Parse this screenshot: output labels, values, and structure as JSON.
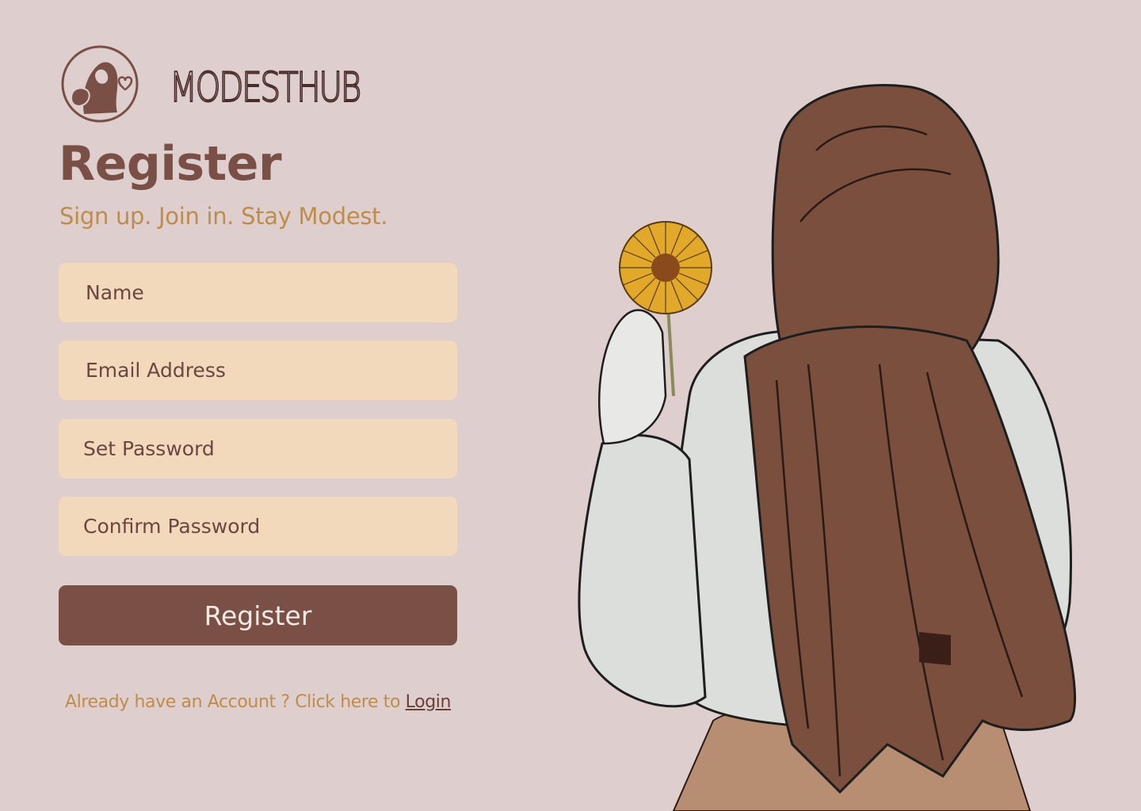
{
  "brand": {
    "name": "MODESTHUB",
    "logo_icon": "hijab-woman-heart-icon"
  },
  "page": {
    "title": "Register",
    "subtitle": "Sign up. Join in. Stay Modest."
  },
  "form": {
    "name_placeholder": "Name",
    "email_placeholder": "Email Address",
    "password_placeholder": "Set Password",
    "confirm_placeholder": "Confirm Password",
    "submit_label": "Register"
  },
  "footer": {
    "prompt": "Already have an Account ? Click here to ",
    "link_label": "Login"
  },
  "illustration": {
    "icon": "woman-in-hijab-holding-flower-illustration"
  },
  "colors": {
    "background": "#decfce",
    "primary": "#7a5046",
    "accent": "#be8c4c",
    "field": "#f2d9bb",
    "hijab": "#7b4f3e",
    "shirt": "#dcdedb",
    "flower": "#e2a82a"
  }
}
